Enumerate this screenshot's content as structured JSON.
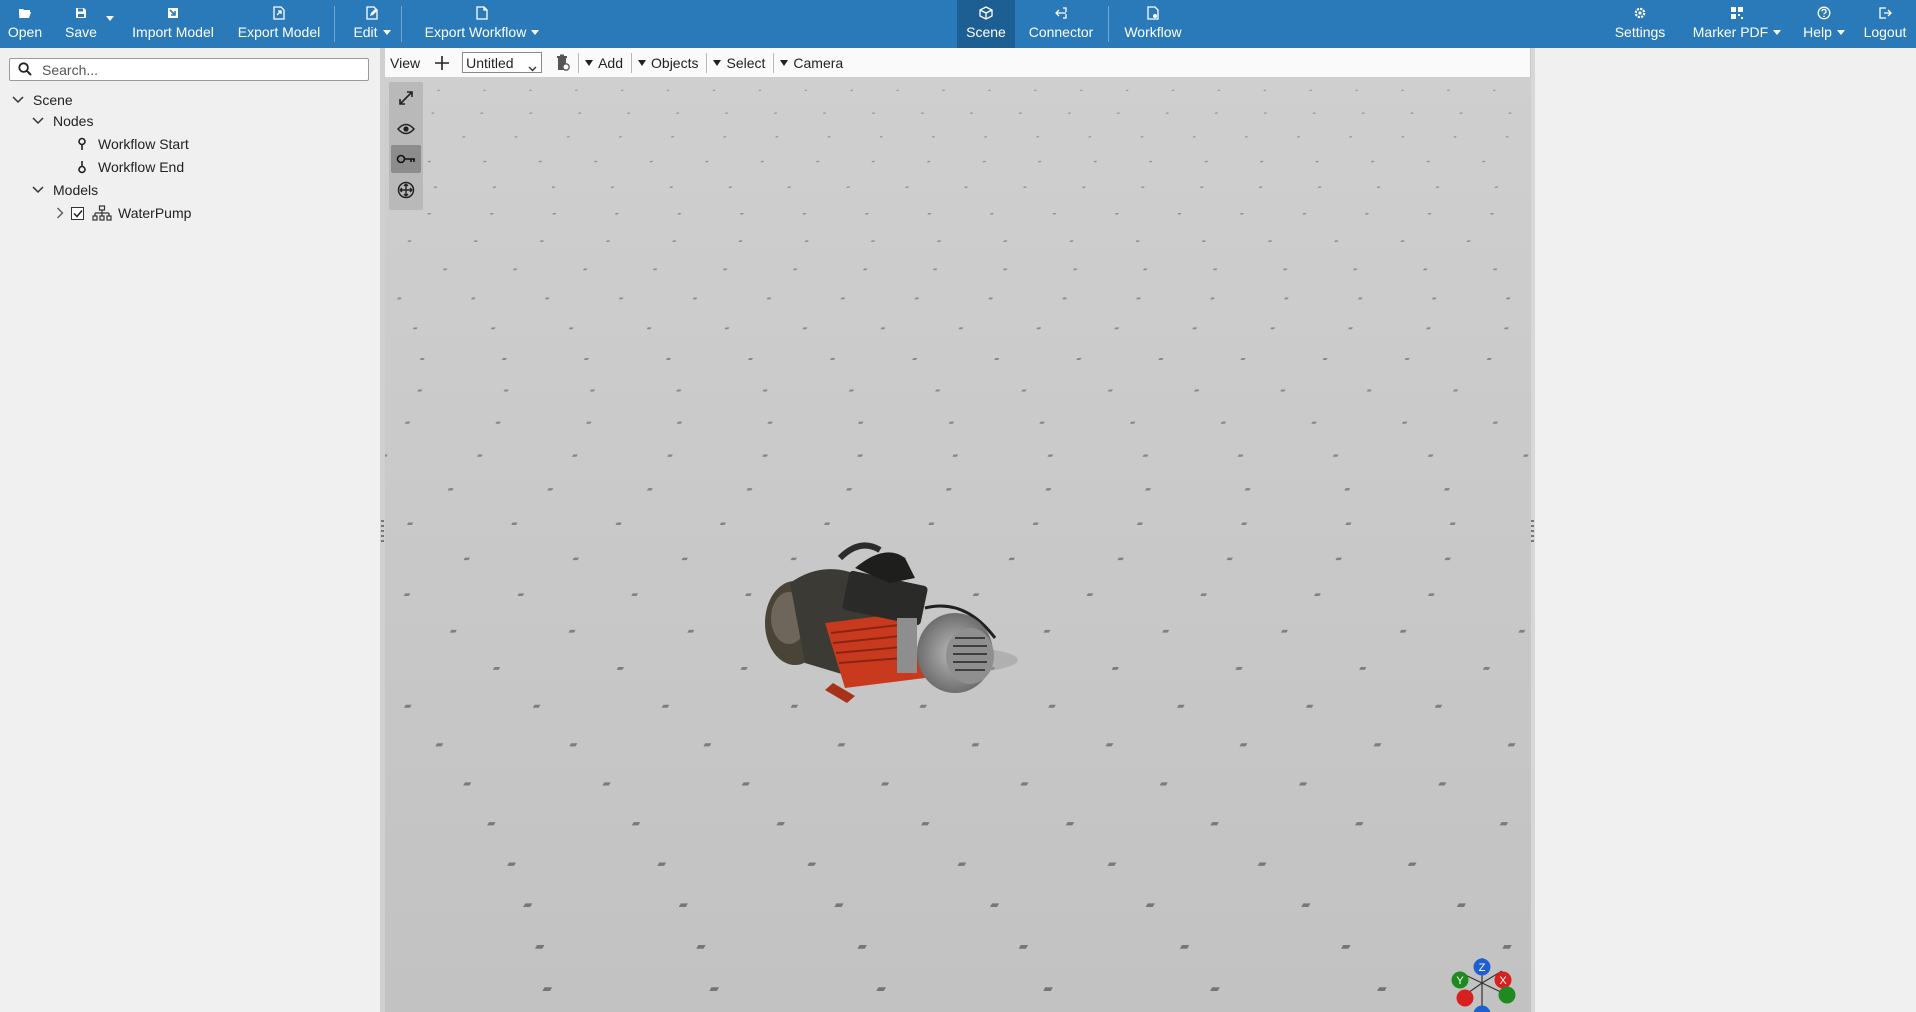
{
  "toolbar": {
    "open": "Open",
    "save": "Save",
    "import_model": "Import Model",
    "export_model": "Export Model",
    "edit": "Edit",
    "export_workflow": "Export Workflow",
    "scene": "Scene",
    "connector": "Connector",
    "workflow": "Workflow",
    "settings": "Settings",
    "marker_pdf": "Marker PDF",
    "help": "Help",
    "logout": "Logout",
    "active_tab": "Scene"
  },
  "search": {
    "placeholder": "Search..."
  },
  "tree": {
    "scene": "Scene",
    "nodes": "Nodes",
    "workflow_start": "Workflow Start",
    "workflow_end": "Workflow End",
    "models": "Models",
    "waterpump": "WaterPump",
    "waterpump_checked": true
  },
  "viewport_toolbar": {
    "view": "View",
    "camera_select": "Untitled",
    "add": "Add",
    "objects": "Objects",
    "select": "Select",
    "camera": "Camera"
  },
  "axis_gizmo": {
    "z": "Z",
    "y": "Y",
    "x": "X"
  },
  "colors": {
    "topbar": "#2a7ab9",
    "active_tab": "#1d5f93",
    "viewport_bg": "#c6c6c6",
    "axis_x": "#d92020",
    "axis_y": "#1f8a1f",
    "axis_z": "#1f5fd0"
  },
  "icons": {
    "open": "folder-open-icon",
    "save": "floppy-icon",
    "import_model": "import-cube-icon",
    "export_model": "export-file-icon",
    "edit": "edit-file-icon",
    "export_workflow": "file-icon",
    "scene": "cube-icon",
    "connector": "connector-icon",
    "workflow": "workflow-file-icon",
    "settings": "gear-icon",
    "marker_pdf": "qr-pdf-icon",
    "help": "help-circle-icon",
    "logout": "logout-icon"
  }
}
